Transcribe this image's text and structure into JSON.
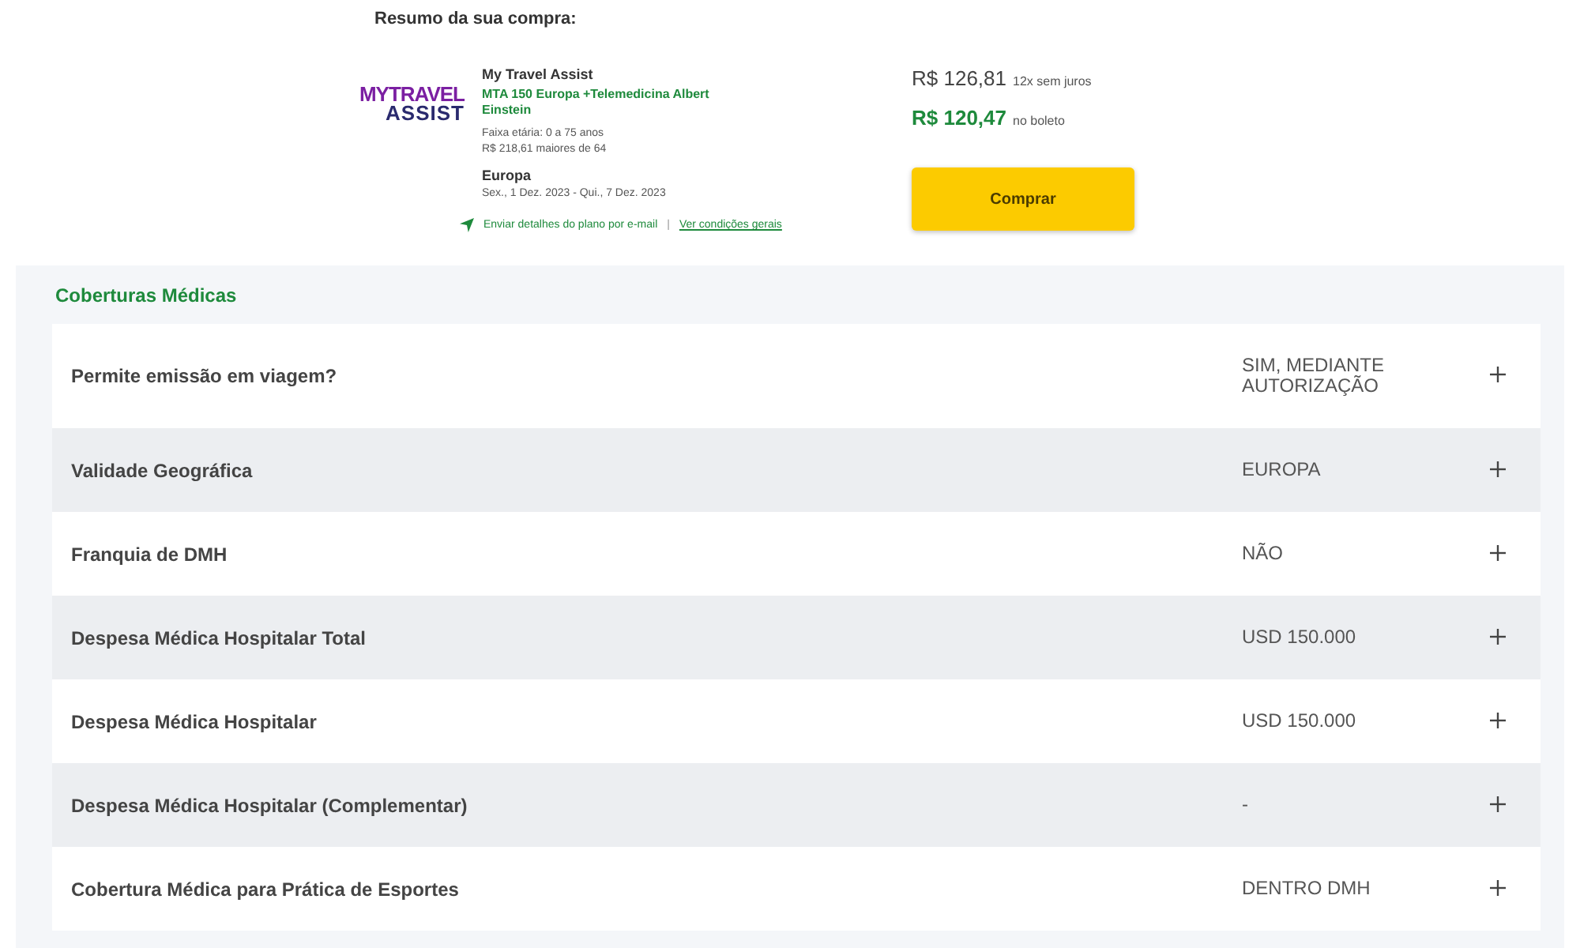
{
  "summary": {
    "heading": "Resumo da sua compra:",
    "logo": {
      "line_1": "MYTRAVEL",
      "line_2": "ASSIST"
    },
    "provider": "My Travel Assist",
    "plan": "MTA 150 Europa +Telemedicina Albert Einstein",
    "age_range": "Faixa etária: 0 a 75 anos",
    "age_surcharge": "R$ 218,61 maiores de 64",
    "destination": "Europa",
    "dates": "Sex., 1 Dez. 2023 - Qui., 7 Dez. 2023",
    "email_link": "Enviar detalhes do plano por e-mail",
    "separator": "|",
    "conditions_link": "Ver condições gerais",
    "installment_price": "R$ 126,81",
    "installment_note": "12x sem juros",
    "boleto_price": "R$ 120,47",
    "boleto_note": "no boleto",
    "buy_button": "Comprar"
  },
  "coverages": {
    "title": "Coberturas Médicas",
    "rows": [
      {
        "label": "Permite emissão em viagem?",
        "value": "SIM, MEDIANTE AUTORIZAÇÃO",
        "expanded": false
      },
      {
        "label": "Validade Geográfica",
        "value": "EUROPA",
        "expanded": false
      },
      {
        "label": "Franquia de DMH",
        "value": "NÃO",
        "expanded": false
      },
      {
        "label": "Despesa Médica Hospitalar Total",
        "value": "USD 150.000",
        "expanded": false
      },
      {
        "label": "Despesa Médica Hospitalar",
        "value": "USD 150.000",
        "expanded": false
      },
      {
        "label": "Despesa Médica Hospitalar (Complementar)",
        "value": "-",
        "expanded": false
      },
      {
        "label": "Cobertura Médica para Prática de Esportes",
        "value": "DENTRO DMH",
        "expanded": false
      }
    ]
  }
}
